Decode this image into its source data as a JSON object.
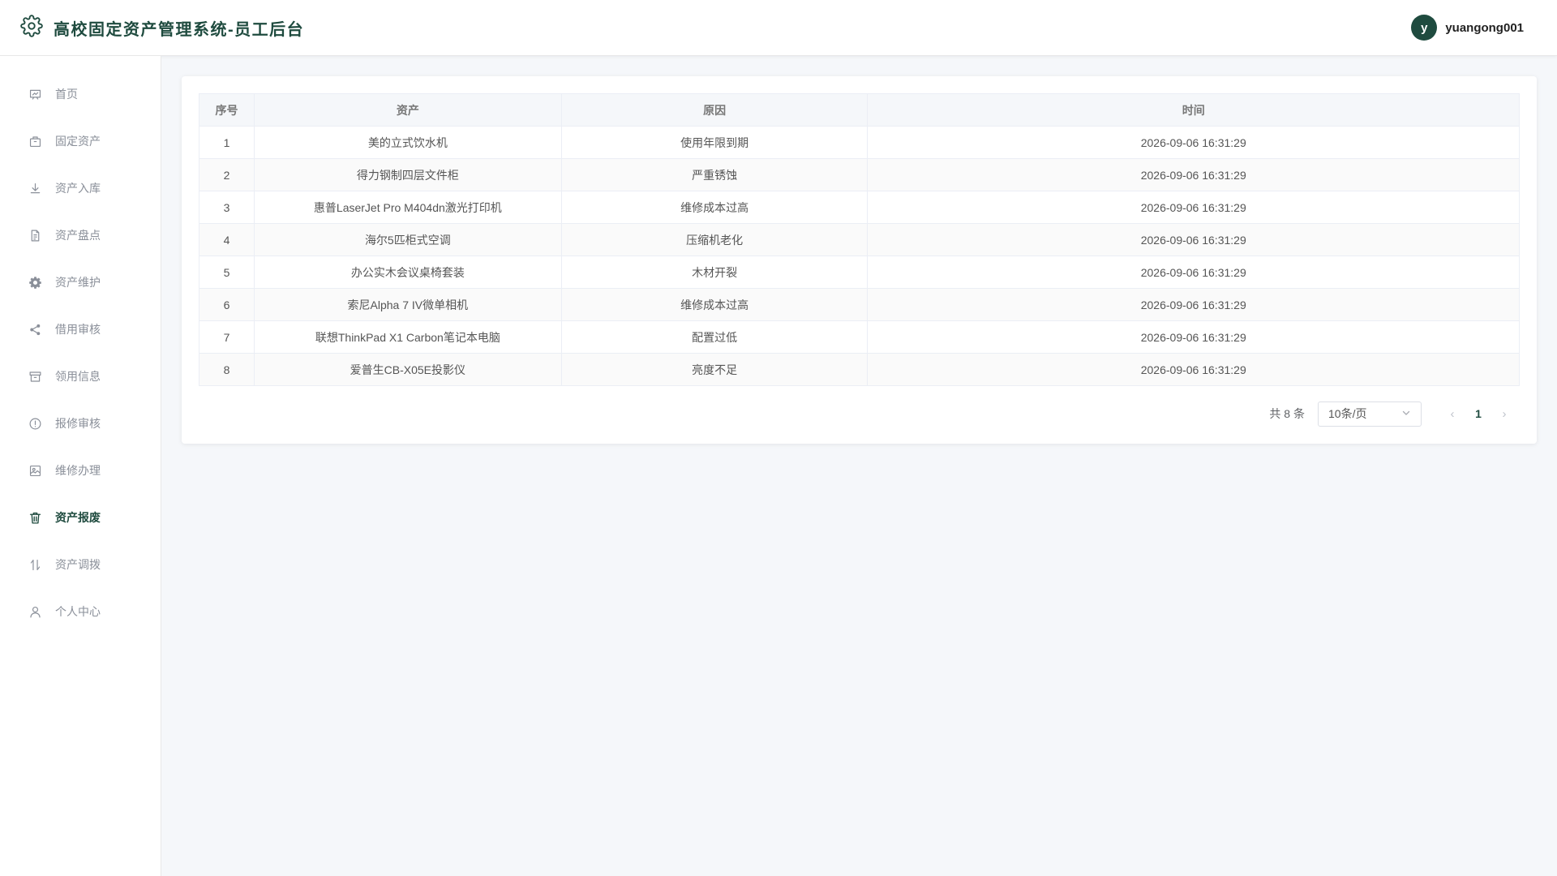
{
  "header": {
    "title": "高校固定资产管理系统-员工后台",
    "avatar_letter": "y",
    "username": "yuangong001"
  },
  "sidebar": {
    "items": [
      {
        "label": "首页",
        "icon": "chart-board-icon"
      },
      {
        "label": "固定资产",
        "icon": "briefcase-icon"
      },
      {
        "label": "资产入库",
        "icon": "download-icon"
      },
      {
        "label": "资产盘点",
        "icon": "document-icon"
      },
      {
        "label": "资产维护",
        "icon": "gear-icon"
      },
      {
        "label": "借用审核",
        "icon": "share-icon"
      },
      {
        "label": "领用信息",
        "icon": "box-icon"
      },
      {
        "label": "报修审核",
        "icon": "warning-circle-icon"
      },
      {
        "label": "维修办理",
        "icon": "picture-icon"
      },
      {
        "label": "资产报废",
        "icon": "trash-icon",
        "active": true
      },
      {
        "label": "资产调拨",
        "icon": "sort-icon"
      },
      {
        "label": "个人中心",
        "icon": "user-icon"
      }
    ]
  },
  "table": {
    "headers": {
      "index": "序号",
      "asset": "资产",
      "reason": "原因",
      "time": "时间"
    },
    "rows": [
      {
        "index": "1",
        "asset": "美的立式饮水机",
        "reason": "使用年限到期",
        "time": "2026-09-06 16:31:29"
      },
      {
        "index": "2",
        "asset": "得力钢制四层文件柜",
        "reason": "严重锈蚀",
        "time": "2026-09-06 16:31:29"
      },
      {
        "index": "3",
        "asset": "惠普LaserJet Pro M404dn激光打印机",
        "reason": "维修成本过高",
        "time": "2026-09-06 16:31:29"
      },
      {
        "index": "4",
        "asset": "海尔5匹柜式空调",
        "reason": "压缩机老化",
        "time": "2026-09-06 16:31:29"
      },
      {
        "index": "5",
        "asset": "办公实木会议桌椅套装",
        "reason": "木材开裂",
        "time": "2026-09-06 16:31:29"
      },
      {
        "index": "6",
        "asset": "索尼Alpha 7 IV微单相机",
        "reason": "维修成本过高",
        "time": "2026-09-06 16:31:29"
      },
      {
        "index": "7",
        "asset": "联想ThinkPad X1 Carbon笔记本电脑",
        "reason": "配置过低",
        "time": "2026-09-06 16:31:29"
      },
      {
        "index": "8",
        "asset": "爱普生CB-X05E投影仪",
        "reason": "亮度不足",
        "time": "2026-09-06 16:31:29"
      }
    ]
  },
  "pagination": {
    "total": "共 8 条",
    "page_size": "10条/页",
    "current_page": "1",
    "prev_icon": "chevron-left-icon",
    "next_icon": "chevron-right-icon"
  },
  "colors": {
    "accent": "#1f4b3f",
    "muted_text": "#8a8f99",
    "background": "#f5f7fa"
  }
}
